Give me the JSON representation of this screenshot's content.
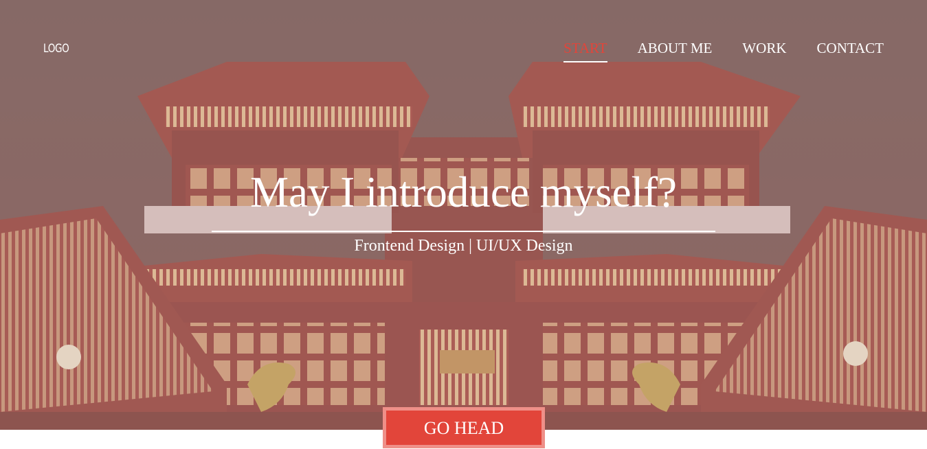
{
  "header": {
    "logo": "LOGO"
  },
  "nav": {
    "items": [
      {
        "label": "START",
        "active": true
      },
      {
        "label": "ABOUT ME",
        "active": false
      },
      {
        "label": "WORK",
        "active": false
      },
      {
        "label": "CONTACT",
        "active": false
      }
    ]
  },
  "hero": {
    "title": "May I introduce myself?",
    "subtitle": "Frontend Design | UI/UX Design",
    "background_image": "temple-photo"
  },
  "cta": {
    "label": "GO HEAD"
  },
  "colors": {
    "accent": "#e2453a",
    "accent_light": "#ef8f88",
    "text_on_hero": "#ffffff"
  }
}
